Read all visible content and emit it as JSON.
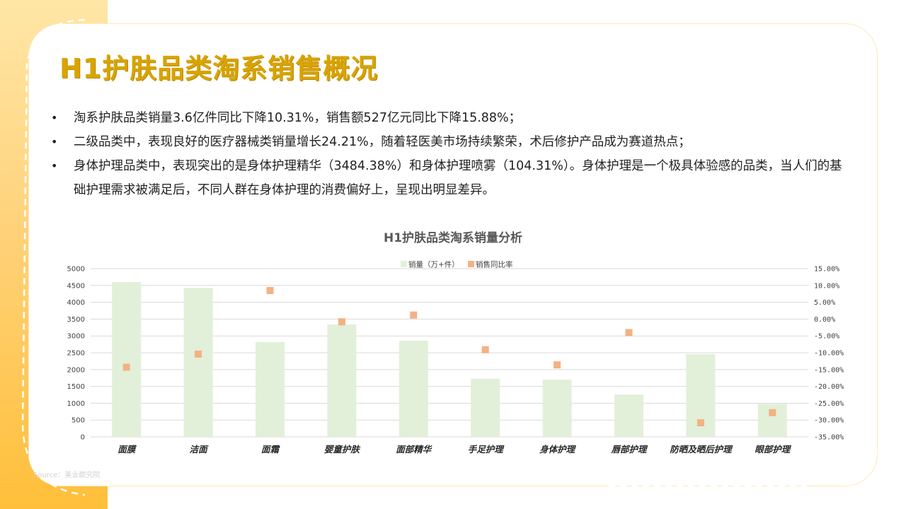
{
  "title": "H1护肤品类淘系销售概况",
  "bullets": [
    "淘系护肤品类销量3.6亿件同比下降10.31%，销售额527亿元同比下降15.88%；",
    "二级品类中，表现良好的医疗器械类销量增长24.21%，随着轻医美市场持续繁荣，术后修护产品成为赛道热点；",
    "身体护理品类中，表现突出的是身体护理精华（3484.38%）和身体护理喷雾（104.31%）。身体护理是一个极具体验感的品类，当人们的基础护理需求被满足后，不同人群在身体护理的消费偏好上，呈现出明显差异。"
  ],
  "source": "Source：美业颜究院",
  "colors": {
    "bar": "#e2f0d9",
    "marker": "#f4b183",
    "title": "#d9a400",
    "band": "#ffc845"
  },
  "chart_data": {
    "type": "bar",
    "title": "H1护肤品类淘系销量分析",
    "legend_position": "top",
    "grid": true,
    "categories": [
      "面膜",
      "洁面",
      "面霜",
      "婴童护肤",
      "面部精华",
      "手足护理",
      "身体护理",
      "唇部护理",
      "防晒及晒后护理",
      "眼部护理"
    ],
    "series": [
      {
        "name": "销量（万+件）",
        "type": "bar",
        "axis": "left",
        "values": [
          4600,
          4430,
          2820,
          3340,
          2860,
          1730,
          1700,
          1260,
          2460,
          980
        ]
      },
      {
        "name": "销售同比率",
        "type": "scatter",
        "axis": "right",
        "values": [
          -14.3,
          -10.4,
          8.5,
          -0.8,
          1.2,
          -9.1,
          -13.6,
          -4.0,
          -30.8,
          -27.8
        ]
      }
    ],
    "ylim": [
      0,
      5000
    ],
    "yticks": [
      "5000",
      "4500",
      "4000",
      "3500",
      "3000",
      "2500",
      "2000",
      "1500",
      "1000",
      "500",
      "0"
    ],
    "y2lim": [
      -35,
      15
    ],
    "y2ticks": [
      "15.00%",
      "10.00%",
      "5.00%",
      "0.00%",
      "-5.00%",
      "-10.00%",
      "-15.00%",
      "-20.00%",
      "-25.00%",
      "-30.00%",
      "-35.00%"
    ]
  }
}
